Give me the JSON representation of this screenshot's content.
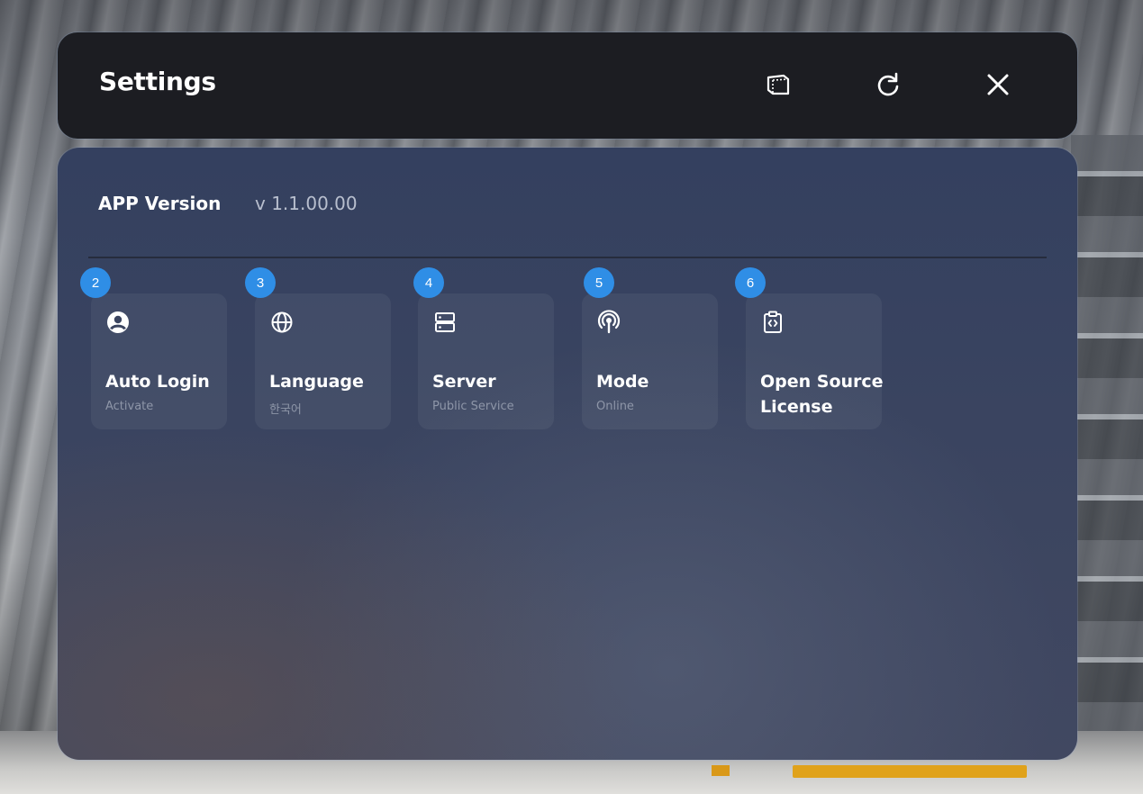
{
  "window": {
    "title": "Settings",
    "buttons": {
      "screen_icon": "screen-frame-icon",
      "refresh_icon": "refresh-icon",
      "close_icon": "close-icon"
    }
  },
  "app_version": {
    "label": "APP Version",
    "value": "v 1.1.00.00"
  },
  "cards": [
    {
      "badge": "2",
      "icon": "user-circle-icon",
      "title": "Auto Login",
      "subtitle": "Activate"
    },
    {
      "badge": "3",
      "icon": "globe-icon",
      "title": "Language",
      "subtitle": "한국어"
    },
    {
      "badge": "4",
      "icon": "server-icon",
      "title": "Server",
      "subtitle": "Public Service"
    },
    {
      "badge": "5",
      "icon": "broadcast-icon",
      "title": "Mode",
      "subtitle": "Online"
    },
    {
      "badge": "6",
      "icon": "code-clipboard-icon",
      "title": "Open Source License",
      "subtitle": ""
    }
  ],
  "colors": {
    "accent": "#2f8ee6",
    "titlebar": "#1c1d22",
    "panel": "#3a4460"
  }
}
